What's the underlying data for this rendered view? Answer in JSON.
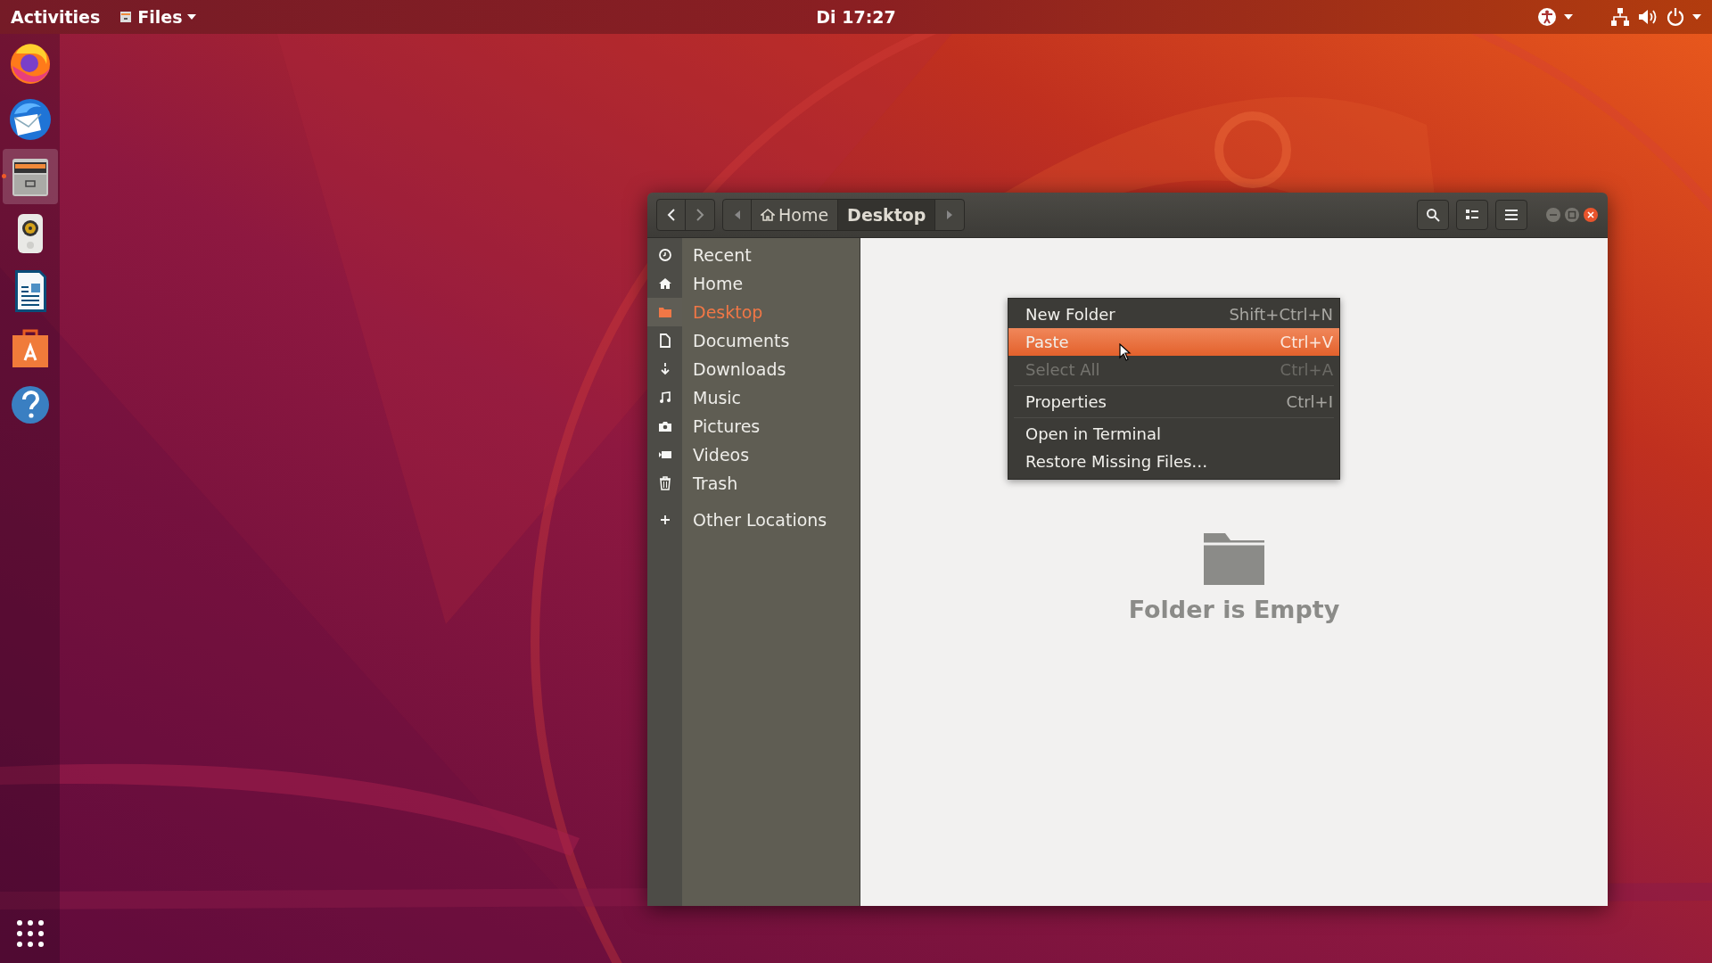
{
  "top_bar": {
    "activities": "Activities",
    "app_menu": {
      "label": "Files"
    },
    "clock": "Di 17:27"
  },
  "dock": {
    "items": [
      {
        "kind": "browser",
        "selected": false
      },
      {
        "kind": "mail",
        "selected": false
      },
      {
        "kind": "files",
        "selected": true
      },
      {
        "kind": "music",
        "selected": false
      },
      {
        "kind": "writer",
        "selected": false
      },
      {
        "kind": "store",
        "selected": false
      },
      {
        "kind": "help",
        "selected": false
      }
    ]
  },
  "window": {
    "nav": {
      "back_disabled": false,
      "forward_disabled": true
    },
    "breadcrumbs": [
      {
        "label": "Home",
        "kind": "home",
        "selected": false
      },
      {
        "label": "Desktop",
        "kind": "folder",
        "selected": true
      }
    ],
    "sidebar": {
      "sections": [
        {
          "items": [
            {
              "label": "Recent",
              "kind": "recent",
              "selected": false
            },
            {
              "label": "Home",
              "kind": "home",
              "selected": false
            },
            {
              "label": "Desktop",
              "kind": "desktop",
              "selected": true
            },
            {
              "label": "Documents",
              "kind": "documents",
              "selected": false
            },
            {
              "label": "Downloads",
              "kind": "downloads",
              "selected": false
            },
            {
              "label": "Music",
              "kind": "music",
              "selected": false
            },
            {
              "label": "Pictures",
              "kind": "pictures",
              "selected": false
            },
            {
              "label": "Videos",
              "kind": "videos",
              "selected": false
            },
            {
              "label": "Trash",
              "kind": "trash",
              "selected": false
            }
          ]
        },
        {
          "items": [
            {
              "label": "Other Locations",
              "kind": "other",
              "selected": false
            }
          ]
        }
      ]
    },
    "context_menu": {
      "items": [
        {
          "label": "New Folder",
          "shortcut": "Shift+Ctrl+N",
          "selected": false,
          "disabled": false,
          "divider_after": false
        },
        {
          "label": "Paste",
          "shortcut": "Ctrl+V",
          "selected": true,
          "disabled": false,
          "divider_after": false
        },
        {
          "label": "Select All",
          "shortcut": "Ctrl+A",
          "selected": false,
          "disabled": true,
          "divider_after": true
        },
        {
          "label": "Properties",
          "shortcut": "Ctrl+I",
          "selected": false,
          "disabled": false,
          "divider_after": true
        },
        {
          "label": "Open in Terminal",
          "selected": false,
          "disabled": false,
          "divider_after": false
        },
        {
          "label": "Restore Missing Files…",
          "selected": false,
          "disabled": false,
          "divider_after": false
        }
      ]
    },
    "empty_message": "Folder is Empty"
  }
}
